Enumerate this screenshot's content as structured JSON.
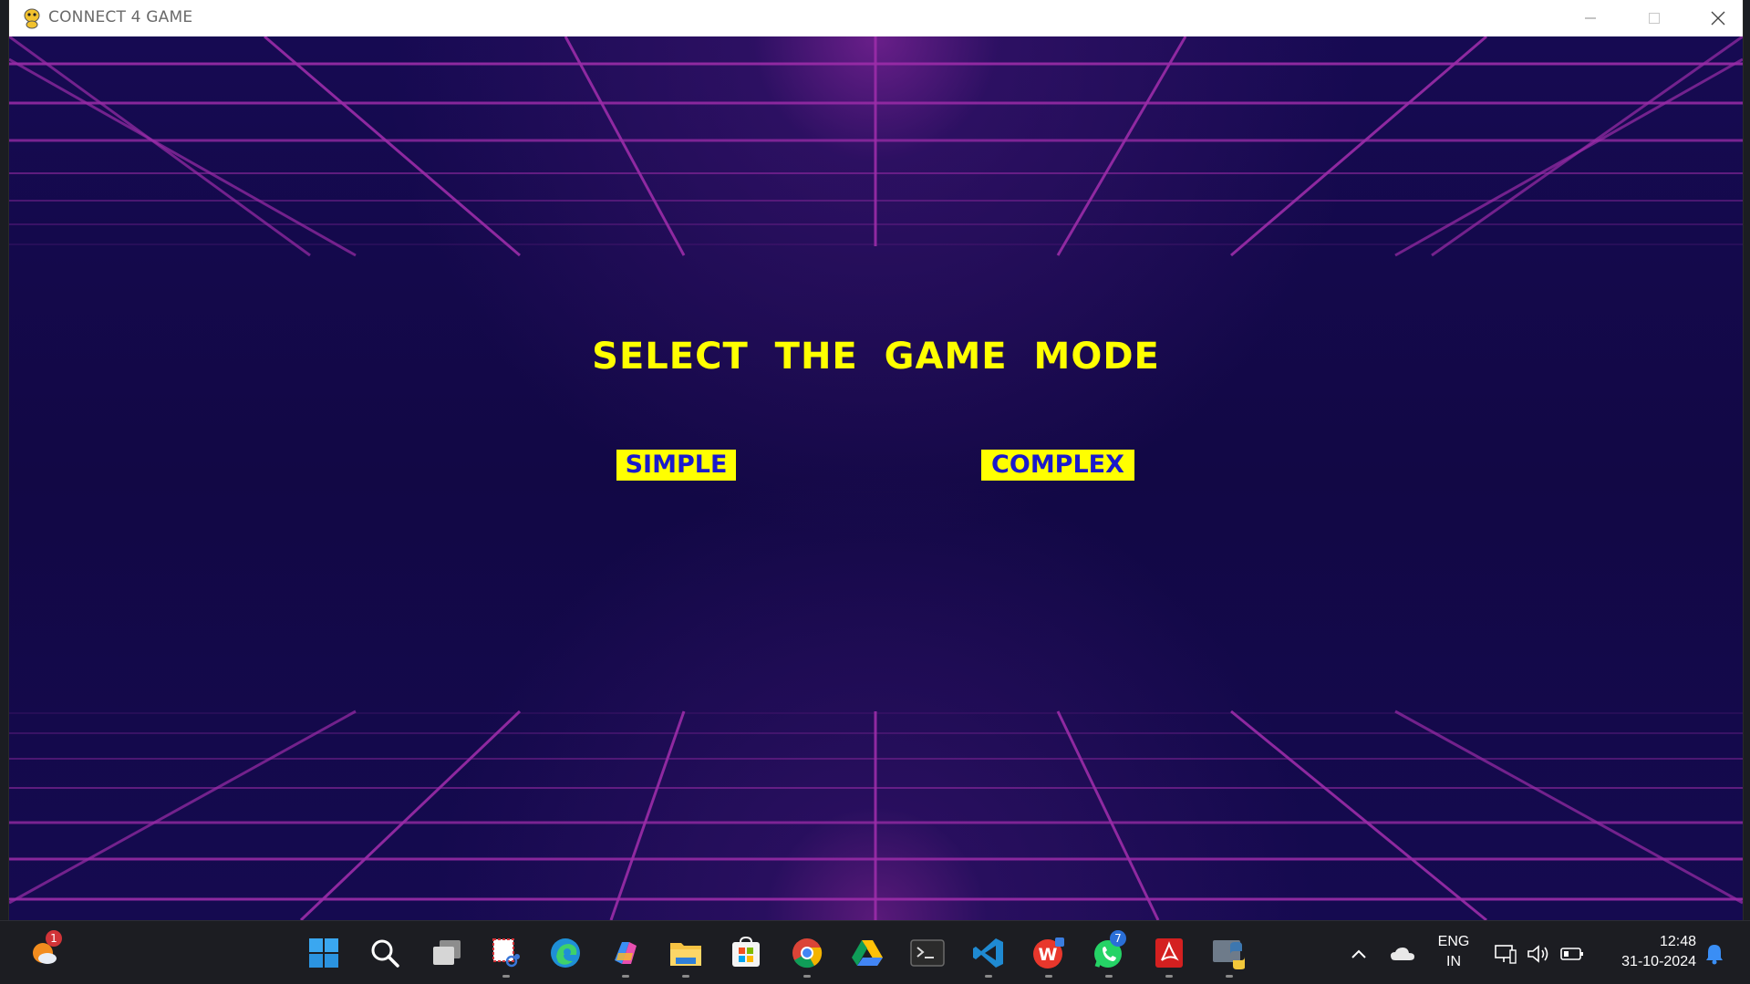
{
  "window": {
    "title": "CONNECT 4 GAME",
    "controls": [
      "minimize",
      "maximize",
      "close"
    ]
  },
  "game": {
    "heading": "SELECT THE GAME MODE",
    "buttons": {
      "simple": "SIMPLE",
      "complex": "COMPLEX"
    },
    "colors": {
      "background": "#140a4c",
      "grid": "#9b2ca8",
      "heading": "#ffff00",
      "button_bg": "#ffff00",
      "button_text": "#1a1acc"
    }
  },
  "taskbar": {
    "weather_badge": "1",
    "apps": [
      "start-icon",
      "search-icon",
      "task-view-icon",
      "snipping-tool-icon",
      "edge-icon",
      "copilot-icon",
      "file-explorer-icon",
      "microsoft-store-icon",
      "chrome-icon",
      "google-drive-icon",
      "terminal-icon",
      "vscode-icon",
      "wps-office-icon",
      "whatsapp-icon",
      "acrobat-icon",
      "python-icon"
    ],
    "whatsapp_badge": "7",
    "tray": {
      "language_line1": "ENG",
      "language_line2": "IN",
      "time": "12:48",
      "date": "31-10-2024"
    }
  }
}
